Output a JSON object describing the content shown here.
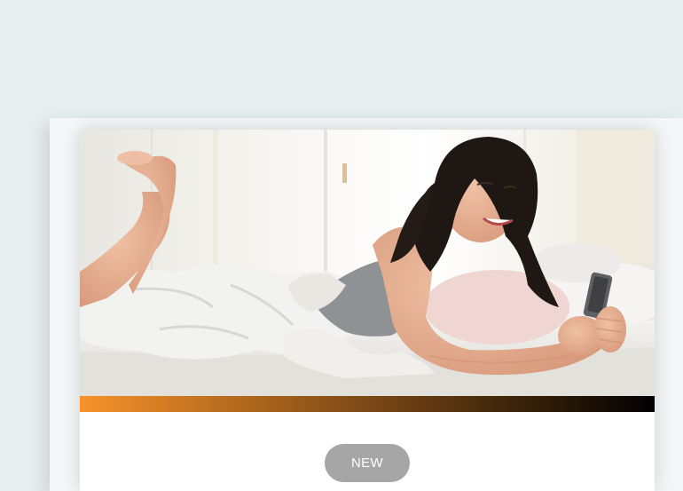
{
  "card": {
    "image_subject": "woman-in-bed-with-phone",
    "badge_label": "NEW"
  },
  "colors": {
    "page_background": "#e6eeee",
    "panel_background": "#f4f7f7",
    "card_background": "#ffffff",
    "accent_gradient_start": "#f7922a",
    "accent_gradient_end": "#000000",
    "badge_background": "#a6a6a6",
    "badge_text": "#ffffff"
  }
}
